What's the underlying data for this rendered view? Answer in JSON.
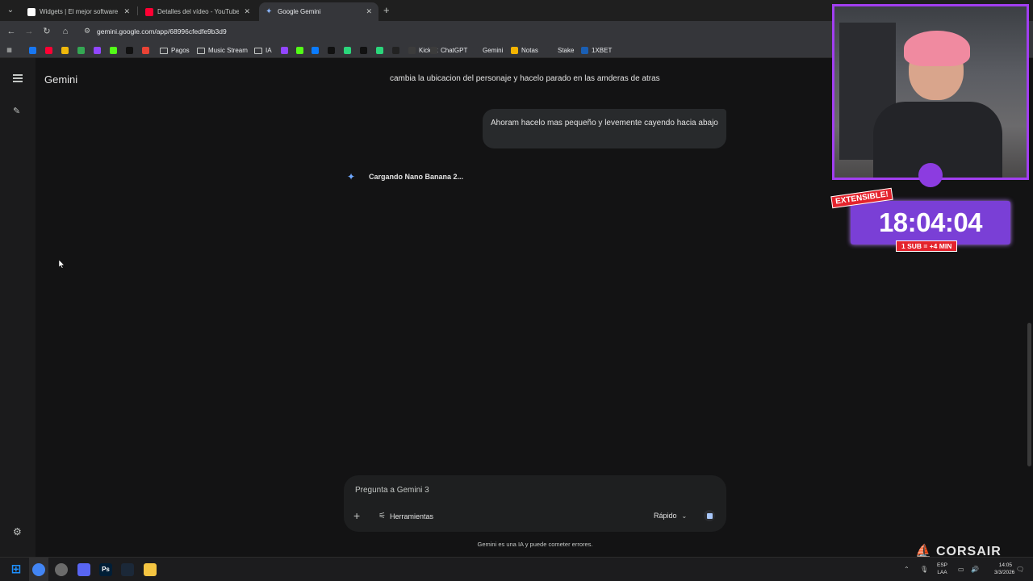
{
  "browser": {
    "tabs": [
      {
        "title": "Widgets | El mejor software par",
        "favicon_color": "#ffffff"
      },
      {
        "title": "Detalles del vídeo - YouTube St",
        "favicon_color": "#ff0033"
      },
      {
        "title": "Google Gemini",
        "favicon_color": "#8ab4f8"
      }
    ],
    "new_tab_label": "+",
    "url": "gemini.google.com/app/68996cfedfe9b3d9",
    "bookmarks": [
      {
        "label": "",
        "icon": "facebook-icon",
        "color": "#1877f2"
      },
      {
        "label": "",
        "icon": "youtube-icon",
        "color": "#ff0033"
      },
      {
        "label": "",
        "icon": "binance-icon",
        "color": "#f0b90b"
      },
      {
        "label": "",
        "icon": "drive-icon",
        "color": "#34a853"
      },
      {
        "label": "",
        "icon": "twitch-icon",
        "color": "#9146ff"
      },
      {
        "label": "",
        "icon": "kick-icon",
        "color": "#53fc18"
      },
      {
        "label": "",
        "icon": "app-icon",
        "color": "#111111"
      },
      {
        "label": "",
        "icon": "gmail-icon",
        "color": "#ea4335"
      },
      {
        "label": "Pagos",
        "icon": "folder-icon"
      },
      {
        "label": "Music Stream",
        "icon": "folder-icon"
      },
      {
        "label": "IA",
        "icon": "folder-icon"
      },
      {
        "label": "",
        "icon": "twitch-icon",
        "color": "#9146ff"
      },
      {
        "label": "",
        "icon": "kick-icon",
        "color": "#53fc18"
      },
      {
        "label": "",
        "icon": "meta-icon",
        "color": "#0a7cff"
      },
      {
        "label": "",
        "icon": "tiktok-icon",
        "color": "#111111"
      },
      {
        "label": "",
        "icon": "app-icon",
        "color": "#2bd67b"
      },
      {
        "label": "",
        "icon": "app-icon",
        "color": "#111111"
      },
      {
        "label": "",
        "icon": "app-icon",
        "color": "#2bd67b"
      },
      {
        "label": "",
        "icon": "app-icon",
        "color": "#222222"
      },
      {
        "label": "Kicklet",
        "icon": "kicklet-icon",
        "color": "#3c3c3c"
      },
      {
        "label": "ChatGPT",
        "icon": "chatgpt-icon",
        "color": "#3c3c3c"
      },
      {
        "label": "Gemini",
        "icon": "gemini-icon",
        "color": "#35363a"
      },
      {
        "label": "Notas",
        "icon": "notes-icon",
        "color": "#f4b400"
      },
      {
        "label": "Stake",
        "icon": "stake-icon",
        "color": "#35363a"
      },
      {
        "label": "1XBET",
        "icon": "1xbet-icon",
        "color": "#1a5fb4"
      }
    ]
  },
  "gemini": {
    "app_title": "Gemini",
    "previous_message": "cambia la ubicacion del personaje y hacelo parado en las amderas de atras",
    "user_message": "Ahoram hacelo mas pequeño y levemente cayendo hacia abajo",
    "loading_text": "Cargando Nano Banana 2...",
    "input_placeholder": "Pregunta a Gemini 3",
    "tools_label": "Herramientas",
    "mode_label": "Rápido",
    "disclaimer": "Gemini es una IA y puede cometer errores."
  },
  "overlay": {
    "badge": "EXTENSIBLE!",
    "timer": "18:04:04",
    "sub_rule": "1 SUB = +4 MIN",
    "brand": "CORSAIR",
    "accent_color": "#a13ef0"
  },
  "taskbar": {
    "language": "ESP",
    "language_sub": "LAA",
    "time": "14:05",
    "date": "3/3/2026",
    "apps": [
      {
        "icon": "windows-icon",
        "color": "#1e90ff",
        "glyph": ""
      },
      {
        "icon": "chrome-icon",
        "color": "#4285f4",
        "glyph": ""
      },
      {
        "icon": "chrome-alt-icon",
        "color": "#6b6b6b",
        "glyph": ""
      },
      {
        "icon": "discord-icon",
        "color": "#5865f2",
        "glyph": ""
      },
      {
        "icon": "photoshop-icon",
        "color": "#001e36",
        "glyph": "Ps"
      },
      {
        "icon": "steam-icon",
        "color": "#1b2838",
        "glyph": ""
      },
      {
        "icon": "file-explorer-icon",
        "color": "#f4c542",
        "glyph": ""
      }
    ]
  }
}
